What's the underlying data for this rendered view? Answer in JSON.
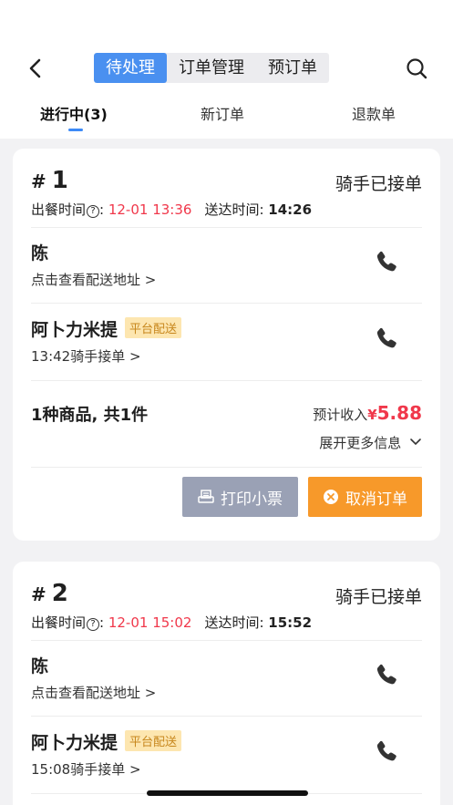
{
  "header": {
    "segments": [
      "待处理",
      "订单管理",
      "预订单"
    ],
    "active_segment": 0,
    "tabs": [
      "进行中(3)",
      "新订单",
      "退款单"
    ],
    "active_tab": 0
  },
  "orders": [
    {
      "hash": "#",
      "number": "1",
      "status": "骑手已接单",
      "meal_label": "出餐时间",
      "meal_time": "12-01 13:36",
      "delivery_label": "送达时间:",
      "delivery_time": "14:26",
      "customer_name": "陈",
      "address_link": "点击查看配送地址",
      "rider_name": "阿卜力米提",
      "rider_tag": "平台配送",
      "rider_accept": "13:42骑手接单",
      "goods_summary": "1种商品, 共1件",
      "income_label": "预计收入",
      "currency": "¥",
      "income_amount": "5.88",
      "expand_label": "展开更多信息",
      "print_label": "打印小票",
      "cancel_label": "取消订单"
    },
    {
      "hash": "#",
      "number": "2",
      "status": "骑手已接单",
      "meal_label": "出餐时间",
      "meal_time": "12-01 15:02",
      "delivery_label": "送达时间:",
      "delivery_time": "15:52",
      "customer_name": "陈",
      "address_link": "点击查看配送地址",
      "rider_name": "阿卜力米提",
      "rider_tag": "平台配送",
      "rider_accept": "15:08骑手接单"
    }
  ],
  "colors": {
    "accent_blue": "#4a90f0",
    "alert_red": "#f0384b",
    "cancel_orange": "#f7992a",
    "print_gray": "#9aa1b5",
    "tag_bg": "#fde6b0"
  },
  "icons": {
    "back": "chevron-left-icon",
    "search": "search-icon",
    "phone": "phone-icon",
    "help": "question-circle-icon",
    "printer": "printer-icon",
    "cancel": "close-circle-icon"
  }
}
